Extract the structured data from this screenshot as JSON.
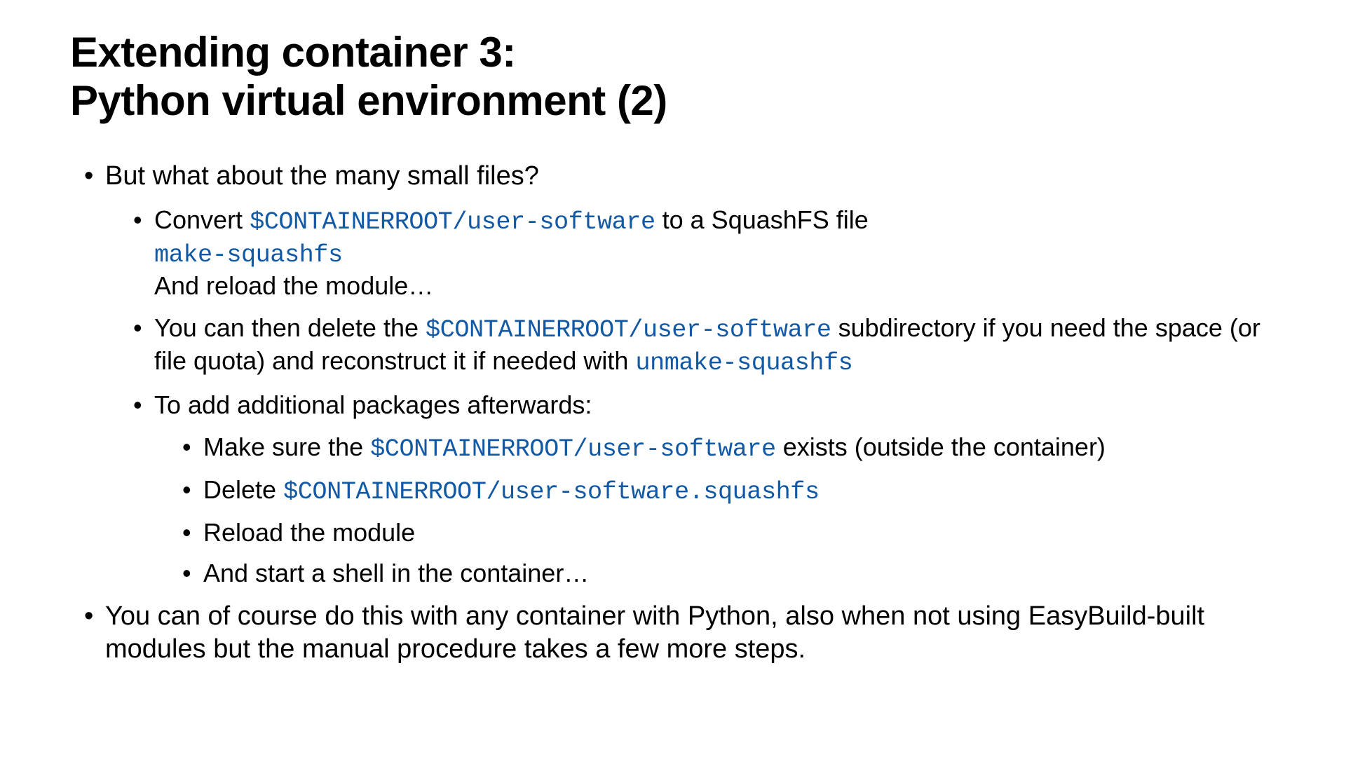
{
  "title_line1": "Extending container 3:",
  "title_line2": "Python virtual environment (2)",
  "b1": "But what about the many small files?",
  "b1a_t1": "Convert ",
  "b1a_c1": "$CONTAINERROOT/user-software",
  "b1a_t2": " to a SquashFS file",
  "b1a_c2": "make-squashfs",
  "b1a_t3": "And reload the module…",
  "b1b_t1": "You can then delete the ",
  "b1b_c1": "$CONTAINERROOT/user-software",
  "b1b_t2": " subdirectory if you need the space (or file quota) and reconstruct it if needed with ",
  "b1b_c2": "unmake-squashfs",
  "b1c": "To add additional packages afterwards:",
  "b1c1_t1": "Make sure the ",
  "b1c1_c1": "$CONTAINERROOT/user-software",
  "b1c1_t2": " exists (outside the container)",
  "b1c2_t1": "Delete ",
  "b1c2_c1": "$CONTAINERROOT/user-software.squashfs",
  "b1c3": "Reload the module",
  "b1c4": "And start a shell in the container…",
  "b2": "You can of course do this with any container with Python, also when not using EasyBuild-built modules but the manual procedure takes a few more steps."
}
